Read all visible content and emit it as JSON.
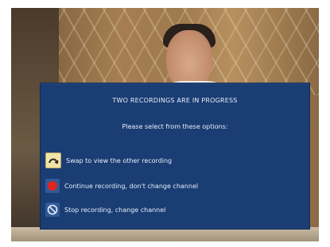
{
  "dialog": {
    "title": "TWO RECORDINGS ARE IN PROGRESS",
    "subtitle": "Please select from these options:",
    "options": [
      {
        "icon": "swap-icon",
        "label": "Swap to view the other recording"
      },
      {
        "icon": "record-icon",
        "label": "Continue recording, don't change channel"
      },
      {
        "icon": "stop-icon",
        "label": "Stop recording, change channel"
      }
    ]
  },
  "colors": {
    "dialog_bg": "#1a3d74",
    "text": "#e9eef7",
    "record_red": "#e2241e",
    "swap_yellow": "#f1e4a6"
  }
}
